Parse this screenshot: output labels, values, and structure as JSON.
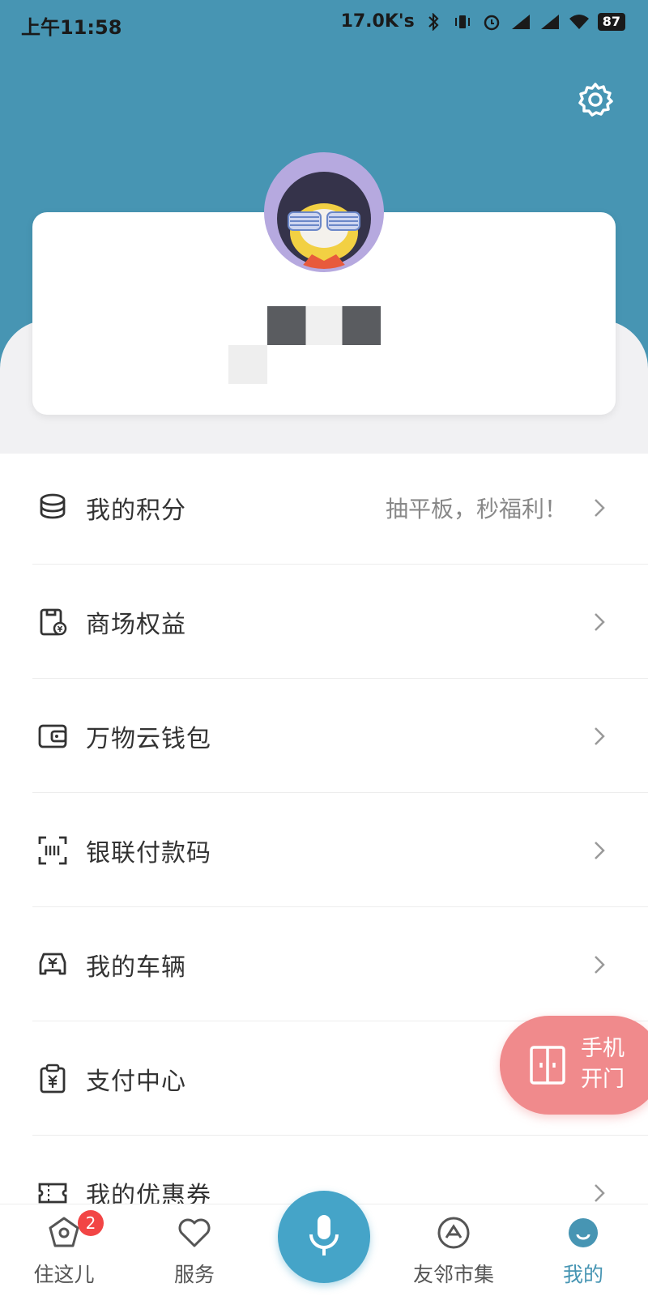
{
  "status_bar": {
    "time": "上午11:58",
    "speed": "17.0K's",
    "battery": "87"
  },
  "colors": {
    "header": "#4795b3",
    "accent": "#45a4c8",
    "door_button": "#f08a8c",
    "badge": "#f24545"
  },
  "menu": {
    "items": [
      {
        "label": "我的积分",
        "extra": "抽平板，秒福利！",
        "icon": "coins-icon"
      },
      {
        "label": "商场权益",
        "extra": "",
        "icon": "mall-bag-icon"
      },
      {
        "label": "万物云钱包",
        "extra": "",
        "icon": "wallet-icon"
      },
      {
        "label": "银联付款码",
        "extra": "",
        "icon": "scan-code-icon"
      },
      {
        "label": "我的车辆",
        "extra": "",
        "icon": "car-icon"
      },
      {
        "label": "支付中心",
        "extra": "",
        "icon": "payment-clipboard-icon"
      },
      {
        "label": "我的优惠券",
        "extra": "",
        "icon": "coupon-icon"
      }
    ]
  },
  "door_button": {
    "line1": "手机",
    "line2": "开门"
  },
  "tabbar": {
    "tabs": [
      {
        "label": "住这儿",
        "badge": "2"
      },
      {
        "label": "服务"
      },
      {
        "label": "友邻市集"
      },
      {
        "label": "我的"
      }
    ]
  }
}
